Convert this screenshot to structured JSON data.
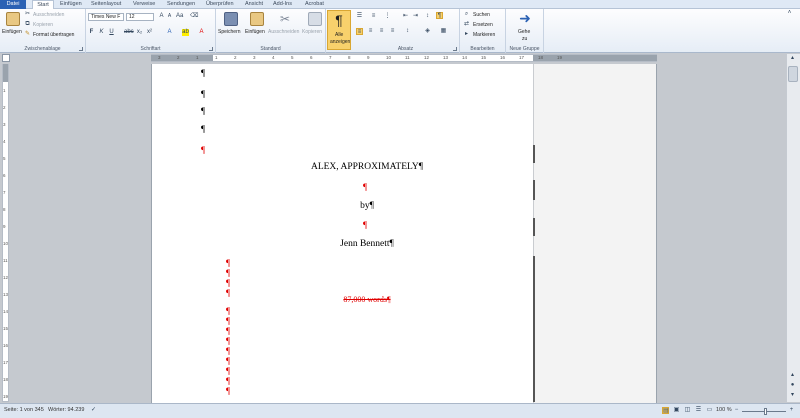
{
  "tabs": [
    {
      "label": "Datei"
    },
    {
      "label": "Start"
    },
    {
      "label": "Einfügen"
    },
    {
      "label": "Seitenlayout"
    },
    {
      "label": "Verweise"
    },
    {
      "label": "Sendungen"
    },
    {
      "label": "Überprüfen"
    },
    {
      "label": "Ansicht"
    },
    {
      "label": "Add-Ins"
    },
    {
      "label": "Acrobat"
    }
  ],
  "clipboard": {
    "paste": "Einfügen",
    "cut": "Ausschneiden",
    "copy": "Kopieren",
    "format_painter": "Format übertragen",
    "group": "Zwischenablage"
  },
  "font": {
    "name": "Times New F",
    "size": "12",
    "group": "Schriftart"
  },
  "standard": {
    "save": "Speichern",
    "paste": "Einfügen",
    "cut": "Ausschneiden",
    "copy": "Kopieren",
    "group": "Standard"
  },
  "show_all": {
    "line1": "Alle",
    "line2": "anzeigen"
  },
  "paragraph": {
    "group": "Absatz"
  },
  "editing": {
    "find": "Suchen",
    "replace": "Ersetzen",
    "select": "Markieren",
    "group": "Bearbeiten"
  },
  "new_group": {
    "goto_line1": "Gehe",
    "goto_line2": "zu",
    "group": "Neue Gruppe"
  },
  "ruler": {
    "h_ticks": [
      "3",
      "2",
      "1",
      "1",
      "2",
      "3",
      "4",
      "5",
      "6",
      "7",
      "8",
      "9",
      "10",
      "11",
      "12",
      "13",
      "14",
      "15",
      "16",
      "17",
      "18",
      "19"
    ],
    "v_ticks": [
      "1",
      "2",
      "3",
      "4",
      "5",
      "6",
      "7",
      "8",
      "9",
      "10",
      "11",
      "12",
      "13",
      "14",
      "15",
      "16",
      "17",
      "18",
      "19",
      "20"
    ]
  },
  "document": {
    "pilcrow": "¶",
    "title": "ALEX, APPROXIMATELY¶",
    "by": "by¶",
    "author": "Jenn Bennett¶",
    "word_count": "87,000 words¶"
  },
  "status": {
    "page": "Seite: 1 von 345",
    "words": "Wörter: 94.239",
    "zoom": "100 %"
  },
  "colors": {
    "accent": "#2b62b4",
    "pilcrow_red": "#e00000",
    "show_all_bg": "#f8d16c"
  }
}
